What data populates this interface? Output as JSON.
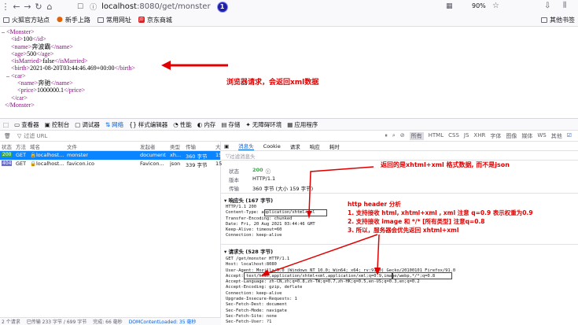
{
  "browser": {
    "url_host": "localhost",
    "url_path": ":8080/get/monster",
    "badge": "1",
    "zoom": "90%"
  },
  "bookmarks": [
    "火狐官方站点",
    "新手上路",
    "常用网址",
    "京东商城"
  ],
  "bookmark_other": "其他书签",
  "xml": {
    "open_monster": "<Monster>",
    "close_monster": "</Monster>",
    "id": {
      "open": "<id>",
      "val": "100",
      "close": "</id>"
    },
    "name": {
      "open": "<name>",
      "val": "奔波霸",
      "close": "</name>"
    },
    "age": {
      "open": "<age>",
      "val": "500",
      "close": "</age>"
    },
    "married": {
      "open": "<isMarried>",
      "val": "false",
      "close": "</isMarried>"
    },
    "birth": {
      "open": "<birth>",
      "val": "2021-08-20T03:44:46.469+00:00",
      "close": "</birth>"
    },
    "open_car": "<car>",
    "close_car": "</car>",
    "car_name": {
      "open": "<name>",
      "val": "奔驰",
      "close": "</name>"
    },
    "car_price": {
      "open": "<price>",
      "val": "1000000.1",
      "close": "</price>"
    }
  },
  "annotations": {
    "browser_request": "浏览器请求，会返回xml数据",
    "returns": "返回的是xhtml+xml 格式数据, 而不是json",
    "h1": "http header 分析",
    "h2": "1. 支持接收 html, xhtml+xml , xml 注意 q=0.9 表示权重为0.9",
    "h3": "2. 支持接收 image 和 */* [所有类型] 注意q=0.8",
    "h4": "3. 所以，服务器会优先返回 xhtml+xml"
  },
  "devtools": {
    "tabs": [
      "查看器",
      "控制台",
      "调试器",
      "网络",
      "样式编辑器",
      "性能",
      "内存",
      "存储",
      "无障碍环境",
      "应用程序"
    ],
    "active_tab": "网络",
    "filter_placeholder": "过滤 URL",
    "filters": [
      "所有",
      "HTML",
      "CSS",
      "JS",
      "XHR",
      "字体",
      "图像",
      "媒体",
      "WS",
      "其他"
    ],
    "active_filter": "所有",
    "columns": [
      "状态",
      "方法",
      "域名",
      "文件",
      "发起者",
      "类型",
      "传输",
      "大"
    ],
    "requests": [
      {
        "status": "200",
        "method": "GET",
        "domain": "localhost...",
        "file": "monster",
        "initiator": "document",
        "type": "xh...",
        "transfer": "360 字节",
        "size": "15"
      },
      {
        "status": "404",
        "method": "GET",
        "domain": "localhost...",
        "file": "favicon.ico",
        "initiator": "Favicon...",
        "type": "json",
        "transfer": "339 字节",
        "size": "15"
      }
    ],
    "footer": {
      "count": "2 个请求",
      "transferred": "已传输 233 字节 / 699 字节",
      "finish": "完成: 66 毫秒",
      "dcl": "DOMContentLoaded: 35 毫秒"
    },
    "detail_tabs": [
      "消息头",
      "Cookie",
      "请求",
      "响应",
      "耗时"
    ],
    "active_detail_tab": "消息头",
    "detail_filter": "过滤消息头",
    "status_label": "状态",
    "status_value": "200",
    "version_label": "版本",
    "version_value": "HTTP/1.1",
    "transfer_label": "传输",
    "transfer_value": "360 字节 (大小 159 字节)",
    "resp_header_title": "响应头 (167 字节)",
    "resp_headers": "HTTP/1.1 200\nContent-Type: application/xhtml+xml\nTransfer-Encoding: chunked\nDate: Fri, 20 Aug 2021 03:44:46 GMT\nKeep-Alive: timeout=60\nConnection: keep-alive",
    "req_header_title": "请求头 (528 字节)",
    "req_headers": "GET /get/monster HTTP/1.1\nHost: localhost:8080\nUser-Agent: Mozilla/5.0 (Windows NT 10.0; Win64; x64; rv:91.0) Gecko/20100101 Firefox/91.0\nAccept: text/html,application/xhtml+xml,application/xml;q=0.9,image/webp,*/*;q=0.8\nAccept-Language: zh-CN,zh;q=0.8,zh-TW;q=0.7,zh-HK;q=0.5,en-US;q=0.3,en;q=0.2\nAccept-Encoding: gzip, deflate\nConnection: keep-alive\nUpgrade-Insecure-Requests: 1\nSec-Fetch-Dest: document\nSec-Fetch-Mode: navigate\nSec-Fetch-Site: none\nSec-Fetch-User: ?1"
  },
  "colors": {
    "accent": "#0061e0",
    "annotation": "#e00000",
    "tag": "#881280"
  }
}
